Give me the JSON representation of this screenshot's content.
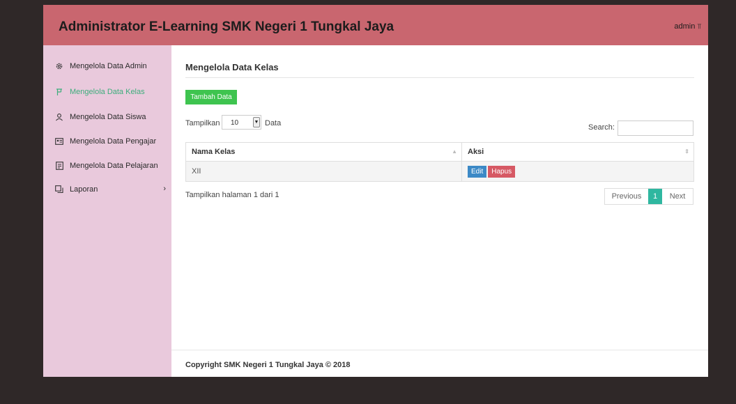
{
  "header": {
    "title": "Administrator E-Learning SMK Negeri 1 Tungkal Jaya",
    "user": "admin"
  },
  "sidebar": {
    "items": [
      {
        "label": "Mengelola Data Admin",
        "icon": "gear-icon"
      },
      {
        "label": "Mengelola Data Kelas",
        "icon": "flag-icon",
        "active": true
      },
      {
        "label": "Mengelola Data Siswa",
        "icon": "user-icon"
      },
      {
        "label": "Mengelola Data Pengajar",
        "icon": "id-card-icon"
      },
      {
        "label": "Mengelola Data Pelajaran",
        "icon": "document-icon"
      },
      {
        "label": "Laporan",
        "icon": "report-icon",
        "arrow": "›"
      }
    ]
  },
  "main": {
    "title": "Mengelola Data Kelas",
    "add_button": "Tambah Data",
    "length": {
      "before": "Tampilkan",
      "value": "10",
      "after": "Data"
    },
    "search_label": "Search:",
    "table": {
      "headers": [
        "Nama Kelas",
        "Aksi"
      ],
      "rows": [
        {
          "nama_kelas": "XII",
          "edit": "Edit",
          "delete": "Hapus"
        }
      ]
    },
    "info": "Tampilkan halaman 1 dari 1",
    "pagination": {
      "previous": "Previous",
      "current": "1",
      "next": "Next"
    }
  },
  "footer": {
    "text": "Copyright SMK Negeri 1 Tungkal Jaya © 2018"
  },
  "colors": {
    "header": "#c9666f",
    "sidebar": "#e9c9dc",
    "active": "#3dae7c",
    "add_button": "#3ec44f",
    "edit": "#3c89c6",
    "delete": "#d65964",
    "page_current": "#2fb7a0"
  }
}
